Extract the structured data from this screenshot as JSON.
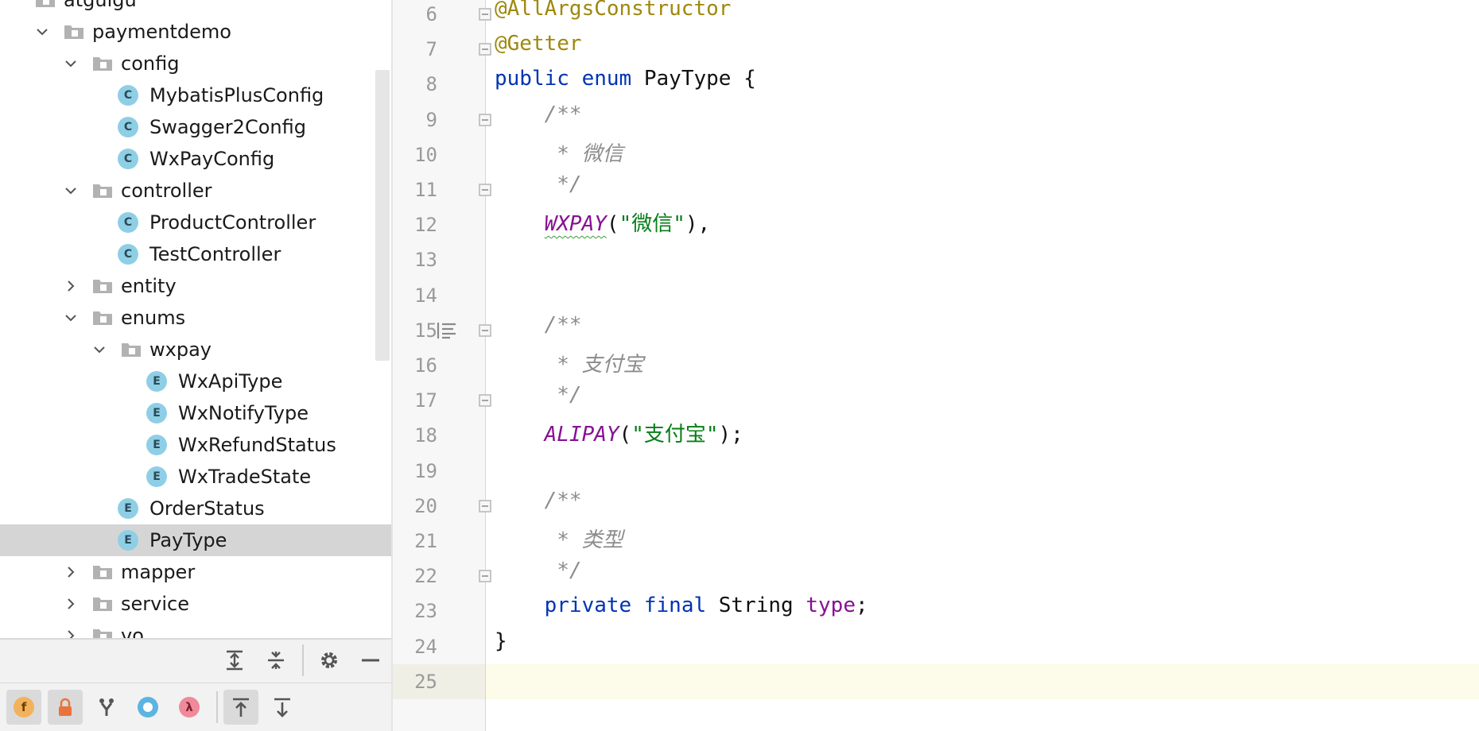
{
  "project_tree": {
    "items": [
      {
        "label": "atguigu",
        "kind": "folder",
        "expanded": null
      },
      {
        "label": "paymentdemo",
        "kind": "folder",
        "expanded": true
      },
      {
        "label": "config",
        "kind": "folder",
        "expanded": true
      },
      {
        "label": "MybatisPlusConfig",
        "kind": "class"
      },
      {
        "label": "Swagger2Config",
        "kind": "class"
      },
      {
        "label": "WxPayConfig",
        "kind": "class"
      },
      {
        "label": "controller",
        "kind": "folder",
        "expanded": true
      },
      {
        "label": "ProductController",
        "kind": "class"
      },
      {
        "label": "TestController",
        "kind": "class"
      },
      {
        "label": "entity",
        "kind": "folder",
        "expanded": false
      },
      {
        "label": "enums",
        "kind": "folder",
        "expanded": true
      },
      {
        "label": "wxpay",
        "kind": "folder",
        "expanded": true
      },
      {
        "label": "WxApiType",
        "kind": "enum"
      },
      {
        "label": "WxNotifyType",
        "kind": "enum"
      },
      {
        "label": "WxRefundStatus",
        "kind": "enum"
      },
      {
        "label": "WxTradeState",
        "kind": "enum"
      },
      {
        "label": "OrderStatus",
        "kind": "enum"
      },
      {
        "label": "PayType",
        "kind": "enum",
        "selected": true
      },
      {
        "label": "mapper",
        "kind": "folder",
        "expanded": false
      },
      {
        "label": "service",
        "kind": "folder",
        "expanded": false
      },
      {
        "label": "vo",
        "kind": "folder",
        "expanded": false
      }
    ],
    "class_icon_letter": "C",
    "enum_icon_letter": "E"
  },
  "toolbar": {
    "top_buttons": [
      "expand-all-icon",
      "collapse-all-icon",
      "gear-icon",
      "hide-icon"
    ],
    "bottom_buttons": [
      {
        "icon": "field-f-icon",
        "letter": "f",
        "color": "#f2b25c"
      },
      {
        "icon": "lock-icon",
        "color": "#e8743b"
      },
      {
        "icon": "fork-icon"
      },
      {
        "icon": "circle-icon",
        "color": "#5cb4e0"
      },
      {
        "icon": "lambda-icon",
        "letter": "λ",
        "color": "#f08a9a"
      },
      {
        "icon": "up-to-top-icon"
      },
      {
        "icon": "down-to-bottom-icon"
      }
    ]
  },
  "editor": {
    "lines": [
      {
        "no": "6",
        "tokens": [
          [
            "ann",
            "@AllArgsConstructor"
          ]
        ]
      },
      {
        "no": "7",
        "tokens": [
          [
            "ann",
            "@Getter"
          ]
        ]
      },
      {
        "no": "8",
        "tokens": [
          [
            "kw",
            "public "
          ],
          [
            "kw",
            "enum "
          ],
          [
            "",
            "PayType {"
          ]
        ]
      },
      {
        "no": "9",
        "tokens": [
          [
            "cmt",
            "    /**"
          ]
        ]
      },
      {
        "no": "10",
        "tokens": [
          [
            "cmt",
            "     * 微信"
          ]
        ]
      },
      {
        "no": "11",
        "tokens": [
          [
            "cmt",
            "     */"
          ]
        ]
      },
      {
        "no": "12",
        "tokens": [
          [
            "",
            "    "
          ],
          [
            "enm squiggle",
            "WXPAY"
          ],
          [
            "",
            "("
          ],
          [
            "str",
            "\"微信\""
          ],
          [
            "",
            "),"
          ]
        ]
      },
      {
        "no": "13",
        "tokens": []
      },
      {
        "no": "14",
        "tokens": []
      },
      {
        "no": "15",
        "tokens": [
          [
            "cmt",
            "    /**"
          ]
        ]
      },
      {
        "no": "16",
        "tokens": [
          [
            "cmt",
            "     * 支付宝"
          ]
        ]
      },
      {
        "no": "17",
        "tokens": [
          [
            "cmt",
            "     */"
          ]
        ]
      },
      {
        "no": "18",
        "tokens": [
          [
            "",
            "    "
          ],
          [
            "enm",
            "ALIPAY"
          ],
          [
            "",
            "("
          ],
          [
            "str",
            "\"支付宝\""
          ],
          [
            "",
            ");"
          ]
        ]
      },
      {
        "no": "19",
        "tokens": []
      },
      {
        "no": "20",
        "tokens": [
          [
            "cmt",
            "    /**"
          ]
        ]
      },
      {
        "no": "21",
        "tokens": [
          [
            "cmt",
            "     * 类型"
          ]
        ]
      },
      {
        "no": "22",
        "tokens": [
          [
            "cmt",
            "     */"
          ]
        ]
      },
      {
        "no": "23",
        "tokens": [
          [
            "",
            "    "
          ],
          [
            "kw",
            "private "
          ],
          [
            "kw",
            "final "
          ],
          [
            "",
            "String "
          ],
          [
            "fld",
            "type"
          ],
          [
            "",
            ";"
          ]
        ]
      },
      {
        "no": "24",
        "tokens": [
          [
            "",
            "}"
          ]
        ]
      },
      {
        "no": "25",
        "tokens": [],
        "current": true
      }
    ],
    "fold_markers": [
      "6",
      "7",
      "9",
      "11",
      "15",
      "17",
      "20",
      "22"
    ],
    "doc_render_icon_line": "15"
  }
}
